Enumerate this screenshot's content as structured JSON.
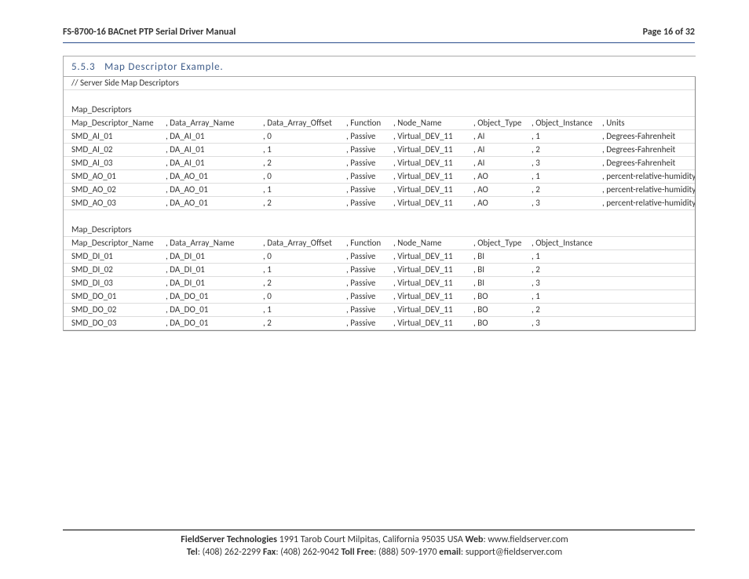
{
  "header": {
    "title": "FS-8700-16 BACnet PTP Serial Driver Manual",
    "page": "Page 16 of 32"
  },
  "section": {
    "number": "5.5.3",
    "title": "Map Descriptor Example."
  },
  "comment": "//     Server Side Map Descriptors",
  "block1": {
    "label": "Map_Descriptors",
    "headers": [
      "Map_Descriptor_Name",
      ", Data_Array_Name",
      ", Data_Array_Offset",
      ", Function",
      ", Node_Name",
      ", Object_Type",
      ", Object_Instance",
      ", Units"
    ],
    "rows": [
      [
        "SMD_AI_01",
        ", DA_AI_01",
        ", 0",
        ", Passive",
        ", Virtual_DEV_11",
        ", AI",
        ", 1",
        ", Degrees-Fahrenheit"
      ],
      [
        "SMD_AI_02",
        ", DA_AI_01",
        ", 1",
        ", Passive",
        ", Virtual_DEV_11",
        ", AI",
        ", 2",
        ", Degrees-Fahrenheit"
      ],
      [
        "SMD_AI_03",
        ", DA_AI_01",
        ", 2",
        ", Passive",
        ", Virtual_DEV_11",
        ", AI",
        ", 3",
        ", Degrees-Fahrenheit"
      ],
      [
        "SMD_AO_01",
        ", DA_AO_01",
        ", 0",
        ", Passive",
        ", Virtual_DEV_11",
        ", AO",
        ", 1",
        ", percent-relative-humidity"
      ],
      [
        "SMD_AO_02",
        ", DA_AO_01",
        ", 1",
        ", Passive",
        ", Virtual_DEV_11",
        ", AO",
        ", 2",
        ", percent-relative-humidity"
      ],
      [
        "SMD_AO_03",
        ", DA_AO_01",
        ", 2",
        ", Passive",
        ", Virtual_DEV_11",
        ", AO",
        ", 3",
        ", percent-relative-humidity"
      ]
    ]
  },
  "block2": {
    "label": "Map_Descriptors",
    "headers": [
      "Map_Descriptor_Name",
      ", Data_Array_Name",
      ", Data_Array_Offset",
      ", Function",
      ", Node_Name",
      ", Object_Type",
      ", Object_Instance"
    ],
    "rows": [
      [
        "SMD_DI_01",
        ", DA_DI_01",
        ", 0",
        ", Passive",
        ", Virtual_DEV_11",
        ", BI",
        ", 1"
      ],
      [
        "SMD_DI_02",
        ", DA_DI_01",
        ", 1",
        ", Passive",
        ", Virtual_DEV_11",
        ", BI",
        ", 2"
      ],
      [
        "SMD_DI_03",
        ", DA_DI_01",
        ", 2",
        ", Passive",
        ", Virtual_DEV_11",
        ", BI",
        ", 3"
      ],
      [
        "SMD_DO_01",
        ", DA_DO_01",
        ", 0",
        ", Passive",
        ", Virtual_DEV_11",
        ", BO",
        ", 1"
      ],
      [
        "SMD_DO_02",
        ", DA_DO_01",
        ", 1",
        ", Passive",
        ", Virtual_DEV_11",
        ", BO",
        ", 2"
      ],
      [
        "SMD_DO_03",
        ", DA_DO_01",
        ", 2",
        ", Passive",
        ", Virtual_DEV_11",
        ", BO",
        ", 3"
      ]
    ]
  },
  "footer": {
    "line1": {
      "company": "FieldServer Technologies",
      "address": " 1991 Tarob Court Milpitas, California 95035 USA   ",
      "web_label": "Web",
      "web_value": ": www.fieldserver.com"
    },
    "line2": {
      "tel_label": "Tel",
      "tel_value": ": (408) 262-2299   ",
      "fax_label": "Fax",
      "fax_value": ": (408) 262-9042   ",
      "toll_label": "Toll Free",
      "toll_value": ": (888) 509-1970   ",
      "email_label": "email",
      "email_value": ": support@fieldserver.com"
    }
  }
}
